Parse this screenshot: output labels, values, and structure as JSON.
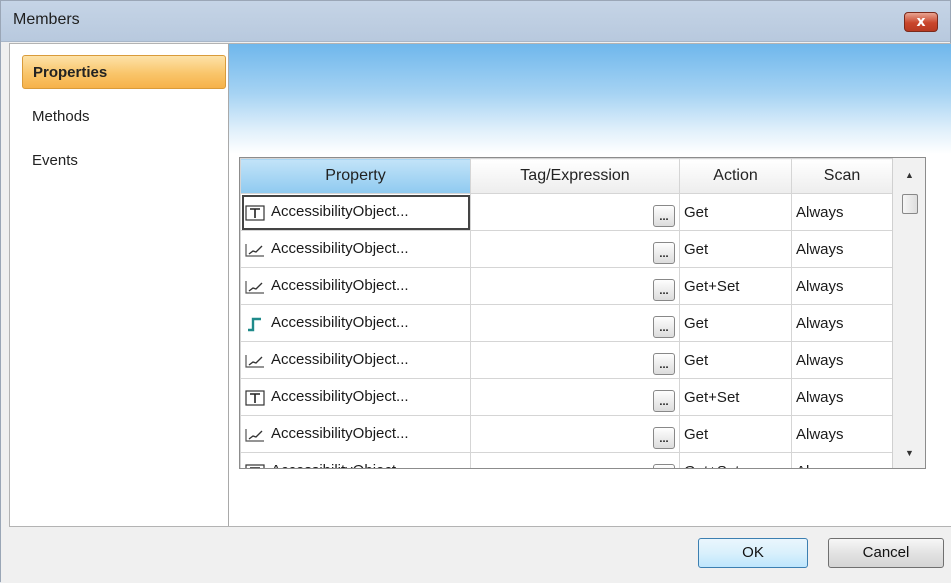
{
  "window": {
    "title": "Members",
    "close_glyph": "x"
  },
  "sidebar": {
    "items": [
      {
        "label": "Properties",
        "active": true
      },
      {
        "label": "Methods",
        "active": false
      },
      {
        "label": "Events",
        "active": false
      }
    ]
  },
  "grid": {
    "columns": [
      "Property",
      "Tag/Expression",
      "Action",
      "Scan"
    ],
    "rows": [
      {
        "icon": "text-property-icon",
        "property": "AccessibilityObject...",
        "tag": "",
        "action": "Get",
        "scan": "Always"
      },
      {
        "icon": "analog-property-icon",
        "property": "AccessibilityObject...",
        "tag": "",
        "action": "Get",
        "scan": "Always"
      },
      {
        "icon": "analog-property-icon",
        "property": "AccessibilityObject...",
        "tag": "",
        "action": "Get+Set",
        "scan": "Always"
      },
      {
        "icon": "digital-property-icon",
        "property": "AccessibilityObject...",
        "tag": "",
        "action": "Get",
        "scan": "Always"
      },
      {
        "icon": "analog-property-icon",
        "property": "AccessibilityObject...",
        "tag": "",
        "action": "Get",
        "scan": "Always"
      },
      {
        "icon": "text-property-icon",
        "property": "AccessibilityObject...",
        "tag": "",
        "action": "Get+Set",
        "scan": "Always"
      },
      {
        "icon": "analog-property-icon",
        "property": "AccessibilityObject...",
        "tag": "",
        "action": "Get",
        "scan": "Always"
      },
      {
        "icon": "text-property-icon",
        "property": "AccessibilityObject...",
        "tag": "",
        "action": "Get+Set",
        "scan": "Always"
      }
    ],
    "browse_button_label": "..."
  },
  "footer": {
    "ok_label": "OK",
    "cancel_label": "Cancel"
  },
  "colors": {
    "active_nav": "#f9c56a",
    "selected_header": "#8fcaf0",
    "close_button": "#c9462c",
    "digital_icon": "#1f8a8a"
  }
}
